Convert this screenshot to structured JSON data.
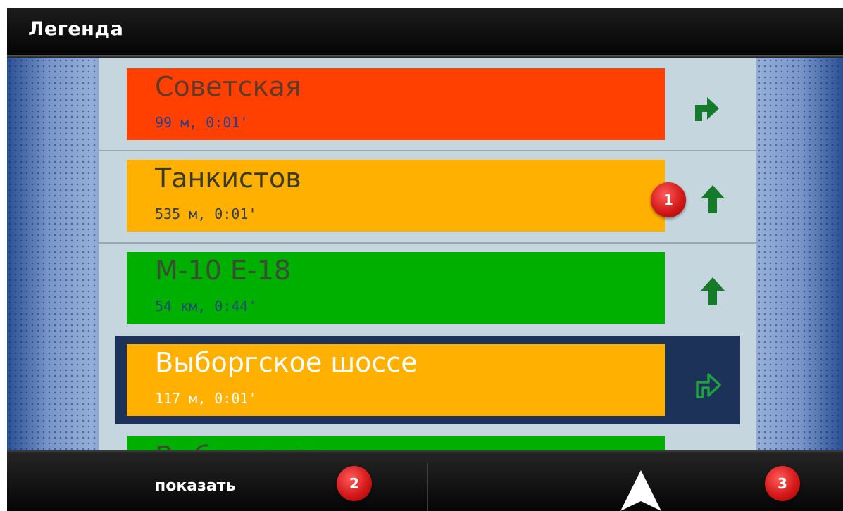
{
  "header": {
    "title": "Легенда"
  },
  "routes": [
    {
      "name": "Советская",
      "distance": "99 м, 0:01'",
      "color": "#ff4000",
      "text_color": "#5e3a2a",
      "distance_color": "#24408e",
      "maneuver": "turn-right"
    },
    {
      "name": "Танкистов",
      "distance": "535 м, 0:01'",
      "color": "#ffb000",
      "text_color": "#3a3a1f",
      "distance_color": "#2e3e60",
      "maneuver": "straight"
    },
    {
      "name": "М-10 Е-18",
      "distance": "54 км, 0:44'",
      "color": "#00b000",
      "text_color": "#3a4e34",
      "distance_color": "#1d4a72",
      "maneuver": "straight"
    },
    {
      "name": "Выборгское шоссе",
      "distance": "117 м, 0:01'",
      "color": "#ffb000",
      "text_color": "#ffffff",
      "distance_color": "#ffffff",
      "maneuver": "turn-right-outline",
      "selected": true
    },
    {
      "name": "Выборгское",
      "color": "#00b000",
      "text_color": "#3a4e34",
      "partial": true
    }
  ],
  "footer": {
    "show_label": "показать"
  },
  "badges": {
    "b1": "1",
    "b2": "2",
    "b3": "3"
  },
  "colors": {
    "selected_row": "#1c3259",
    "list_background": "#c5d6df",
    "badge": "#d41a1a",
    "arrow": "#157a2a"
  }
}
